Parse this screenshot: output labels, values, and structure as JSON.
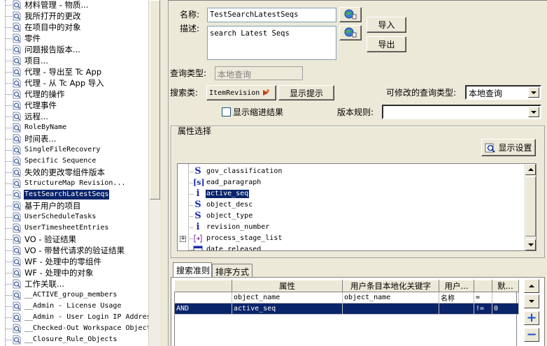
{
  "tree": {
    "items": [
      {
        "label": "材料管理 - 物质...",
        "mono": false
      },
      {
        "label": "我所打开的更改",
        "mono": false
      },
      {
        "label": "在项目中的对象",
        "mono": false
      },
      {
        "label": "零件",
        "mono": false
      },
      {
        "label": "问题报告版本...",
        "mono": false
      },
      {
        "label": "项目...",
        "mono": false
      },
      {
        "label": "代理 - 导出至 Tc App",
        "mono": false
      },
      {
        "label": "代理 - 从 Tc App 导入",
        "mono": false
      },
      {
        "label": "代理的操作",
        "mono": false
      },
      {
        "label": "代理事件",
        "mono": false
      },
      {
        "label": "远程...",
        "mono": false
      },
      {
        "label": "RoleByName",
        "mono": true
      },
      {
        "label": "时间表...",
        "mono": false
      },
      {
        "label": "SingleFileRecovery",
        "mono": true
      },
      {
        "label": "Specific Sequence",
        "mono": true
      },
      {
        "label": "失效的更改零组件版本",
        "mono": false
      },
      {
        "label": "StructureMap Revision...",
        "mono": true
      },
      {
        "label": "TestSearchLatestSeqs",
        "mono": true,
        "selected": true
      },
      {
        "label": "基于用户的项目",
        "mono": false
      },
      {
        "label": "UserScheduleTasks",
        "mono": true
      },
      {
        "label": "UserTimesheetEntries",
        "mono": true
      },
      {
        "label": "VO - 验证结果",
        "mono": false
      },
      {
        "label": "VO - 带替代请求的验证结果",
        "mono": false
      },
      {
        "label": "WF - 处理中的零组件",
        "mono": false
      },
      {
        "label": "WF - 处理中的对象",
        "mono": false
      },
      {
        "label": "工作关联...",
        "mono": false
      },
      {
        "label": "__ACTIVE_group_members",
        "mono": true
      },
      {
        "label": "__Admin - License Usage",
        "mono": true
      },
      {
        "label": "__Admin - User Login IP Address",
        "mono": true
      },
      {
        "label": "__Checked-Out Workspace Objects",
        "mono": true
      },
      {
        "label": "__Closure_Rule_Objects",
        "mono": true
      }
    ]
  },
  "form": {
    "name_label": "名称:",
    "name_value": "TestSearchLatestSeqs",
    "desc_label": "描述:",
    "desc_value": "search Latest Seqs",
    "import_button": "导入",
    "export_button": "导出",
    "query_type_label": "查询类型:",
    "query_type_value": "本地查询",
    "search_class_label": "搜索类:",
    "search_class_value": "ItemRevision",
    "show_hint_button": "显示提示",
    "modifiable_type_label": "可修改的查询类型:",
    "modifiable_type_value": "本地查询",
    "show_indented_label": "显示缩进结果",
    "revision_rule_label": "版本规则:",
    "revision_rule_value": ""
  },
  "attributes": {
    "group_title": "属性选择",
    "display_settings_button": "显示设置",
    "items": [
      {
        "icon": "S",
        "name": "gov_classification"
      },
      {
        "icon": "[s]",
        "name": "ead_paragraph"
      },
      {
        "icon": "i",
        "name": "active_seq",
        "selected": true
      },
      {
        "icon": "S",
        "name": "object_desc"
      },
      {
        "icon": "S",
        "name": "object_type"
      },
      {
        "icon": "i",
        "name": "revision_number"
      },
      {
        "icon": "[->]",
        "name": "process_stage_list",
        "expandable": true
      },
      {
        "icon": "date",
        "name": "date_released"
      }
    ]
  },
  "tabs": [
    {
      "label": "搜索准则",
      "active": true
    },
    {
      "label": "排序方式",
      "active": false
    }
  ],
  "criteria": {
    "headers": [
      "",
      "属性",
      "用户条目本地化关键字",
      "用户...",
      "",
      "默..."
    ],
    "rows": [
      {
        "cells": [
          "",
          "object_name",
          "object_name",
          "名称",
          "=",
          ""
        ],
        "selected": false
      },
      {
        "cells": [
          "AND",
          "active_seq",
          "",
          "",
          "!=",
          "0"
        ],
        "selected": true
      }
    ]
  },
  "colors": {
    "selection": "#0a246a",
    "background": "#ece9d8"
  }
}
